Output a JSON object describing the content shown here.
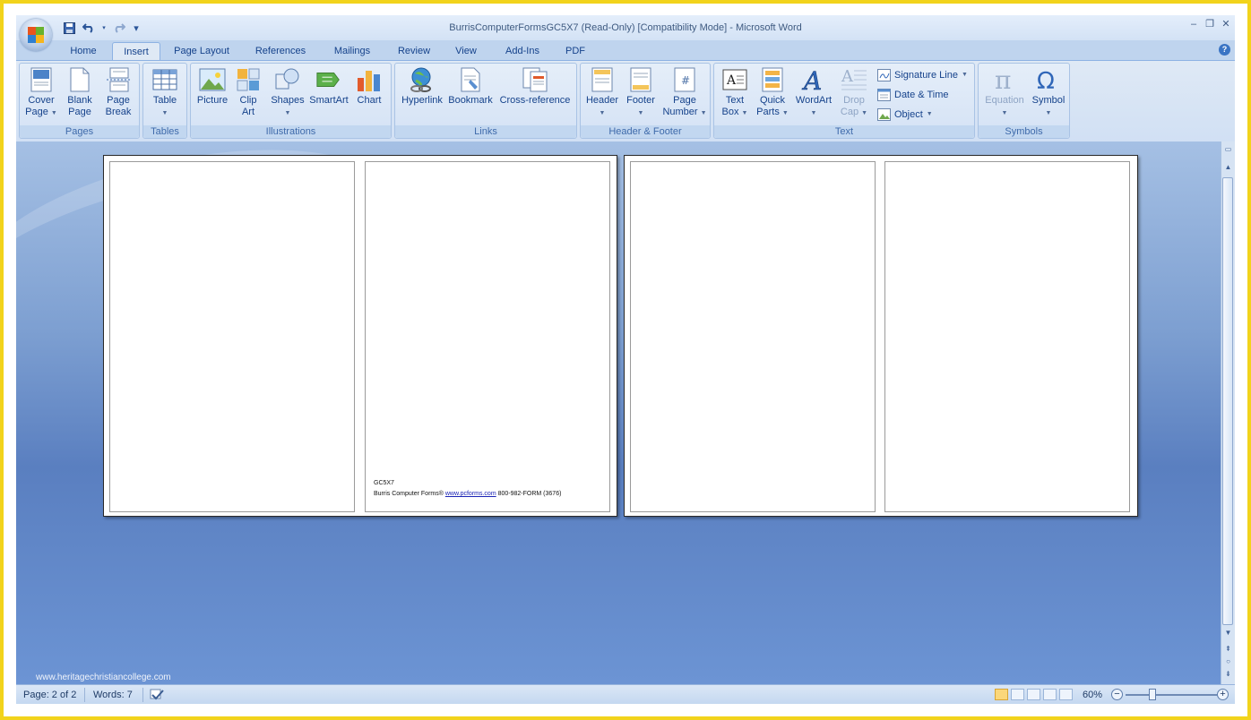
{
  "window": {
    "title": "BurrisComputerFormsGC5X7 (Read-Only) [Compatibility Mode] - Microsoft Word",
    "minimize": "–",
    "restore": "❐",
    "close": "✕",
    "qat_customize": "▾"
  },
  "tabs": [
    "Home",
    "Insert",
    "Page Layout",
    "References",
    "Mailings",
    "Review",
    "View",
    "Add-Ins",
    "PDF"
  ],
  "help": "?",
  "ribbon": {
    "pages": {
      "label": "Pages",
      "cover_page": [
        "Cover",
        "Page"
      ],
      "blank_page": [
        "Blank",
        "Page"
      ],
      "page_break": [
        "Page",
        "Break"
      ]
    },
    "tables": {
      "label": "Tables",
      "table": "Table"
    },
    "illustrations": {
      "label": "Illustrations",
      "picture": "Picture",
      "clip_art": [
        "Clip",
        "Art"
      ],
      "shapes": "Shapes",
      "smartart": "SmartArt",
      "chart": "Chart"
    },
    "links": {
      "label": "Links",
      "hyperlink": "Hyperlink",
      "bookmark": "Bookmark",
      "cross_reference": "Cross-reference"
    },
    "header_footer": {
      "label": "Header & Footer",
      "header": "Header",
      "footer": "Footer",
      "page_number": [
        "Page",
        "Number"
      ]
    },
    "text": {
      "label": "Text",
      "text_box": [
        "Text",
        "Box"
      ],
      "quick_parts": [
        "Quick",
        "Parts"
      ],
      "wordart": "WordArt",
      "drop_cap": [
        "Drop",
        "Cap"
      ],
      "signature_line": "Signature Line",
      "date_time": "Date & Time",
      "object": "Object"
    },
    "symbols": {
      "label": "Symbols",
      "equation": "Equation",
      "symbol": "Symbol"
    }
  },
  "document": {
    "footer_line1": "GC5X7",
    "footer_company": "Burris Computer Forms®",
    "footer_link": "www.pcforms.com",
    "footer_phone": "800-982-FORM (3676)"
  },
  "watermark": "www.heritagechristiancollege.com",
  "status": {
    "page": "Page: 2 of 2",
    "words": "Words: 7",
    "zoom": "60%",
    "zoom_out": "−",
    "zoom_in": "+"
  },
  "colors": {
    "frame": "#f2d31b",
    "ribbon": "#dfe9f5",
    "doc_background": "#6c94d4"
  }
}
